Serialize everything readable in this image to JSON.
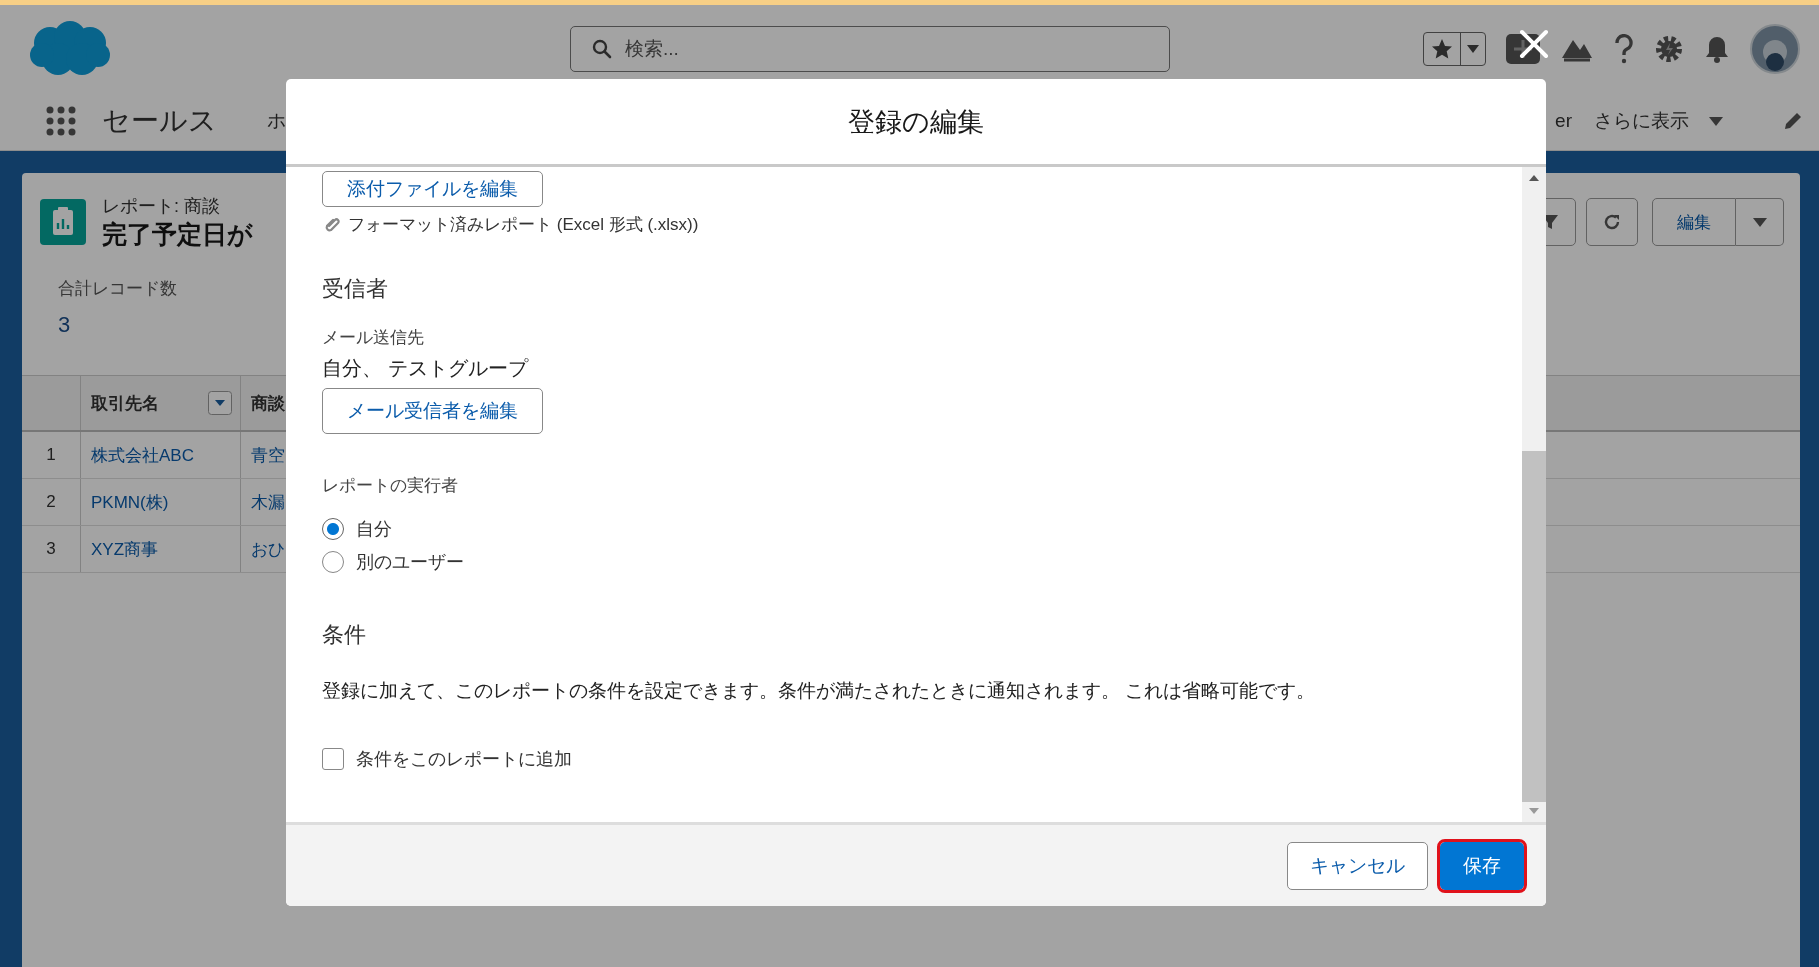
{
  "header": {
    "search": {
      "placeholder": "検索..."
    }
  },
  "nav": {
    "app_name": "セールス",
    "items": [
      "ホ",
      "er"
    ],
    "more": "さらに表示"
  },
  "report": {
    "type_label": "レポート: 商談",
    "title": "完了予定日が",
    "edit_button": "編集",
    "record_count_label": "合計レコード数",
    "record_count": "3"
  },
  "table": {
    "columns": [
      "取引先名",
      "商談"
    ],
    "rows": [
      {
        "number": "1",
        "cells": [
          "株式会社ABC",
          "青空"
        ]
      },
      {
        "number": "2",
        "cells": [
          "PKMN(株)",
          "木漏"
        ]
      },
      {
        "number": "3",
        "cells": [
          "XYZ商事",
          "おひ"
        ]
      }
    ]
  },
  "modal": {
    "title": "登録の編集",
    "attachments": {
      "edit_button": "添付ファイルを編集",
      "file": "フォーマット済みレポート (Excel 形式 (.xlsx))"
    },
    "recipients": {
      "heading": "受信者",
      "label": "メール送信先",
      "value": "自分、 テストグループ",
      "edit_button": "メール受信者を編集"
    },
    "run_as": {
      "label": "レポートの実行者",
      "options": [
        {
          "label": "自分",
          "selected": true
        },
        {
          "label": "別のユーザー",
          "selected": false
        }
      ]
    },
    "conditions": {
      "heading": "条件",
      "description": "登録に加えて、このレポートの条件を設定できます。条件が満たされたときに通知されます。 これは省略可能です。",
      "checkbox": {
        "label": "条件をこのレポートに追加",
        "checked": false
      }
    },
    "buttons": [
      {
        "label": "キャンセル",
        "kind": "neutral",
        "focused": false
      },
      {
        "label": "保存",
        "kind": "brand",
        "focused": true
      }
    ]
  }
}
